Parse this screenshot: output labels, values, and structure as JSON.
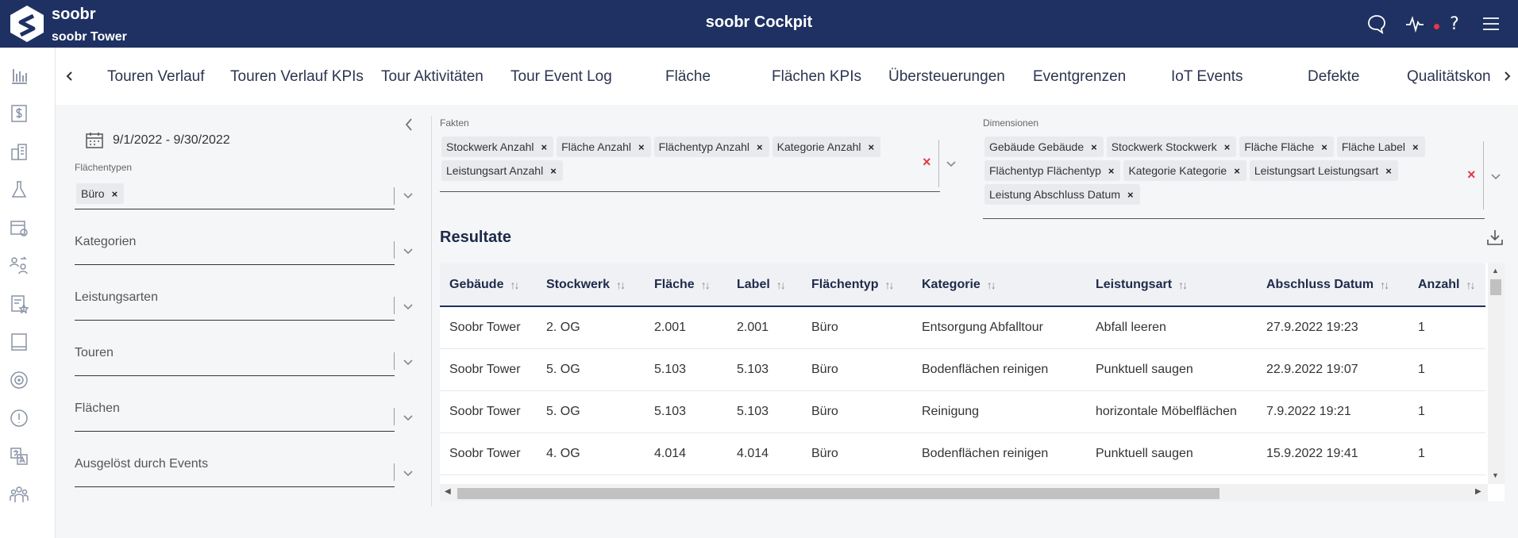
{
  "header": {
    "brand_name": "soobr",
    "tenant": "soobr Tower",
    "title": "soobr Cockpit"
  },
  "tabs": [
    "Touren Verlauf",
    "Touren Verlauf KPIs",
    "Tour Aktivitäten",
    "Tour Event Log",
    "Fläche",
    "Flächen KPIs",
    "Übersteuerungen",
    "Eventgrenzen",
    "IoT Events",
    "Defekte",
    "Qualitätskon"
  ],
  "filters": {
    "date_range": "9/1/2022 - 9/30/2022",
    "flaechentypen_label": "Flächentypen",
    "flaechentypen_chip": "Büro",
    "kategorien": "Kategorien",
    "leistungsarten": "Leistungsarten",
    "touren": "Touren",
    "flaechen": "Flächen",
    "ausgeloest": "Ausgelöst durch Events"
  },
  "fakten": {
    "label": "Fakten",
    "chips": [
      "Stockwerk Anzahl",
      "Fläche Anzahl",
      "Flächentyp Anzahl",
      "Kategorie Anzahl",
      "Leistungsart Anzahl"
    ]
  },
  "dimensionen": {
    "label": "Dimensionen",
    "chips": [
      "Gebäude Gebäude",
      "Stockwerk Stockwerk",
      "Fläche Fläche",
      "Fläche Label",
      "Flächentyp Flächentyp",
      "Kategorie Kategorie",
      "Leistungsart Leistungsart",
      "Leistung Abschluss Datum"
    ]
  },
  "results": {
    "title": "Resultate",
    "columns": [
      "Gebäude",
      "Stockwerk",
      "Fläche",
      "Label",
      "Flächentyp",
      "Kategorie",
      "Leistungsart",
      "Abschluss Datum",
      "Anzahl"
    ],
    "rows": [
      [
        "Soobr Tower",
        "2. OG",
        "2.001",
        "2.001",
        "Büro",
        "Entsorgung Abfalltour",
        "Abfall leeren",
        "27.9.2022 19:23",
        "1"
      ],
      [
        "Soobr Tower",
        "5. OG",
        "5.103",
        "5.103",
        "Büro",
        "Bodenflächen reinigen",
        "Punktuell saugen",
        "22.9.2022 19:07",
        "1"
      ],
      [
        "Soobr Tower",
        "5. OG",
        "5.103",
        "5.103",
        "Büro",
        "Reinigung",
        "horizontale Möbelflächen",
        "7.9.2022 19:21",
        "1"
      ],
      [
        "Soobr Tower",
        "4. OG",
        "4.014",
        "4.014",
        "Büro",
        "Bodenflächen reinigen",
        "Punktuell saugen",
        "15.9.2022 19:41",
        "1"
      ]
    ]
  },
  "colors": {
    "header_bg": "#1e3162",
    "clear_red": "#e53945"
  },
  "icons": {
    "header": [
      "chat-icon",
      "activity-icon",
      "help-icon",
      "menu-icon"
    ],
    "rail": [
      "analytics-icon",
      "dollar-icon",
      "buildings-icon",
      "flask-icon",
      "calendar-clock-icon",
      "transfer-icon",
      "report-star-icon",
      "tablet-icon",
      "target-icon",
      "alert-icon",
      "translate-icon",
      "team-icon"
    ]
  }
}
